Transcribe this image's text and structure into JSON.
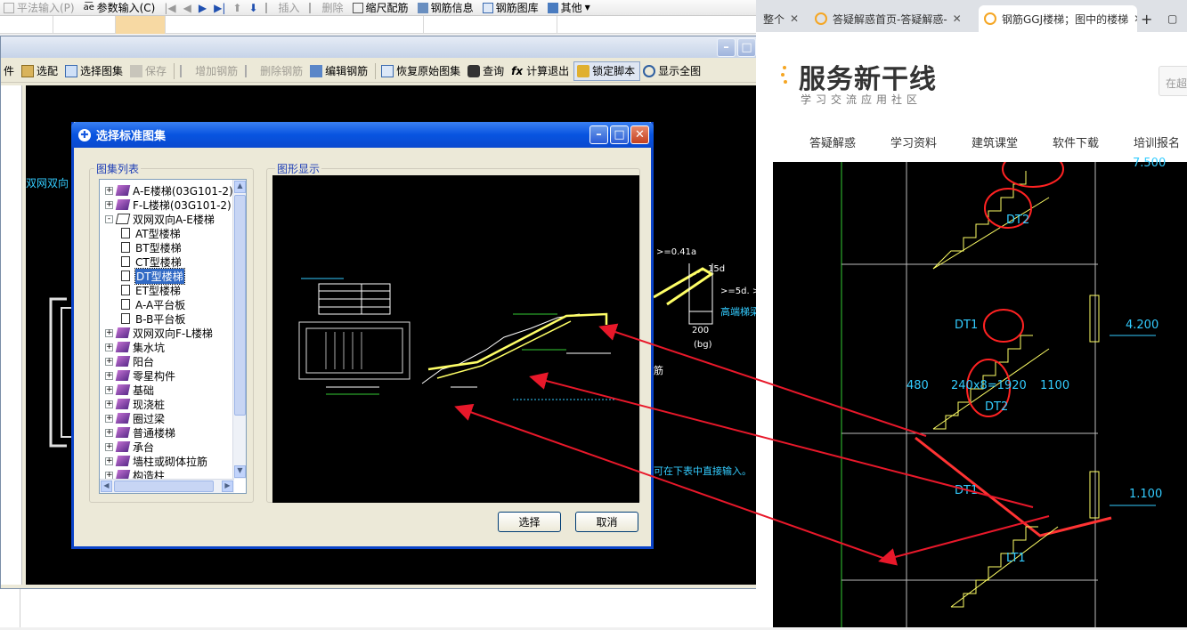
{
  "back_toolbar": {
    "items": [
      {
        "label": "平法输入(P)",
        "disabled": true
      },
      {
        "label": "参数输入(C)",
        "disabled": false
      },
      {
        "label": "插入",
        "disabled": true
      },
      {
        "label": "删除",
        "disabled": true
      },
      {
        "label": "缩尺配筋",
        "disabled": false
      },
      {
        "label": "钢筋信息",
        "disabled": false
      },
      {
        "label": "钢筋图库",
        "disabled": false
      },
      {
        "label": "其他",
        "disabled": false
      }
    ]
  },
  "editor": {
    "toolbar": [
      {
        "label": "件",
        "disabled": false
      },
      {
        "label": "选配",
        "disabled": false
      },
      {
        "label": "选择图集",
        "disabled": false
      },
      {
        "label": "保存",
        "disabled": true
      },
      {
        "label": "增加钢筋",
        "disabled": true
      },
      {
        "label": "删除钢筋",
        "disabled": true
      },
      {
        "label": "编辑钢筋",
        "disabled": false
      },
      {
        "label": "恢复原始图集",
        "disabled": false
      },
      {
        "label": "查询",
        "disabled": false
      },
      {
        "label": "计算退出",
        "disabled": false
      },
      {
        "label": "锁定脚本",
        "disabled": false
      },
      {
        "label": "显示全图",
        "disabled": false
      }
    ],
    "overflow": "»",
    "canvas_left_text": "双网双向",
    "canvas_hint": "可在下表中直接输入。",
    "canvas_labels": [
      ">=0.41a",
      "15d",
      ">=5d. >=h",
      "高端梯梁",
      "200",
      "(bg)",
      "筋"
    ]
  },
  "dialog": {
    "title": "选择标准图集",
    "list_group": "图集列表",
    "preview_group": "图形显示",
    "tree": [
      {
        "label": "A-E楼梯(03G101-2)",
        "level": 0,
        "type": "book",
        "expander": "+"
      },
      {
        "label": "F-L楼梯(03G101-2)",
        "level": 0,
        "type": "book",
        "expander": "+"
      },
      {
        "label": "双网双向A-E楼梯",
        "level": 0,
        "type": "openbook",
        "expander": "-"
      },
      {
        "label": "AT型楼梯",
        "level": 1,
        "type": "doc"
      },
      {
        "label": "BT型楼梯",
        "level": 1,
        "type": "doc"
      },
      {
        "label": "CT型楼梯",
        "level": 1,
        "type": "doc"
      },
      {
        "label": "DT型楼梯",
        "level": 1,
        "type": "doc",
        "selected": true
      },
      {
        "label": "ET型楼梯",
        "level": 1,
        "type": "doc"
      },
      {
        "label": "A-A平台板",
        "level": 1,
        "type": "doc"
      },
      {
        "label": "B-B平台板",
        "level": 1,
        "type": "doc"
      },
      {
        "label": "双网双向F-L楼梯",
        "level": 0,
        "type": "book",
        "expander": "+"
      },
      {
        "label": "集水坑",
        "level": 0,
        "type": "book",
        "expander": "+"
      },
      {
        "label": "阳台",
        "level": 0,
        "type": "book",
        "expander": "+"
      },
      {
        "label": "零星构件",
        "level": 0,
        "type": "book",
        "expander": "+"
      },
      {
        "label": "基础",
        "level": 0,
        "type": "book",
        "expander": "+"
      },
      {
        "label": "现浇桩",
        "level": 0,
        "type": "book",
        "expander": "+"
      },
      {
        "label": "圈过梁",
        "level": 0,
        "type": "book",
        "expander": "+"
      },
      {
        "label": "普通楼梯",
        "level": 0,
        "type": "book",
        "expander": "+"
      },
      {
        "label": "承台",
        "level": 0,
        "type": "book",
        "expander": "+"
      },
      {
        "label": "墙柱或砌体拉筋",
        "level": 0,
        "type": "book",
        "expander": "+"
      },
      {
        "label": "构造柱",
        "level": 0,
        "type": "book",
        "expander": "+"
      }
    ],
    "select_button": "选择",
    "cancel_button": "取消"
  },
  "browser": {
    "tabs": [
      {
        "label": "整个",
        "active": false
      },
      {
        "label": "答疑解惑首页-答疑解惑-",
        "active": false
      },
      {
        "label": "钢筋GGJ楼梯；图中的楼梯",
        "active": true
      }
    ],
    "new_tab": "+",
    "logo": "服务新干线",
    "logo_sub": "学习交流应用社区",
    "search_placeholder": "在超",
    "nav": [
      "答疑解惑",
      "学习资料",
      "建筑课堂",
      "软件下载",
      "培训报名"
    ],
    "cad_labels": {
      "levels": [
        "4.200",
        "1.100",
        "7.500"
      ],
      "stairs": [
        "DT2",
        "DT1",
        "DT2",
        "DT1",
        "LT1",
        "DT1"
      ],
      "dims": [
        "480",
        "240x8=1920",
        "1100"
      ]
    }
  },
  "colors": {
    "dialog_border": "#0a43c8",
    "cad_bg": "#000000",
    "cad_yellow": "#ffff66",
    "cad_cyan": "#33ccff",
    "cad_green": "#33cc33",
    "arrow_red": "#e8182a"
  }
}
